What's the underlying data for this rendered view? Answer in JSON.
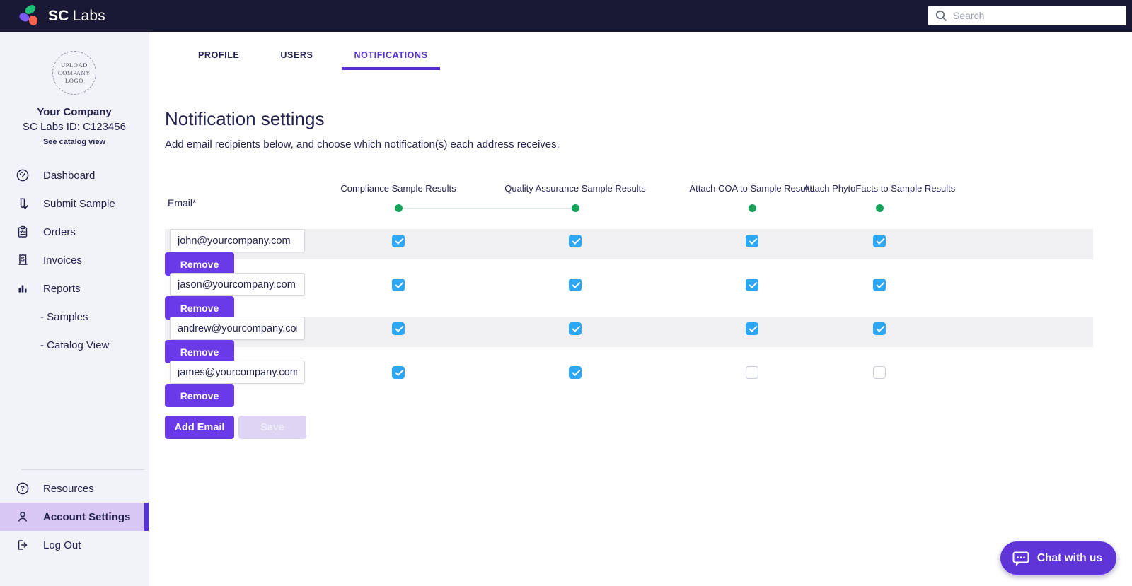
{
  "topbar": {
    "brand_bold": "SC",
    "brand_light": "Labs",
    "search_placeholder": "Search"
  },
  "sidebar": {
    "upload_logo_lines": [
      "UPLOAD",
      "COMPANY",
      "LOGO"
    ],
    "company_name": "Your Company",
    "company_id": "SC Labs ID: C123456",
    "catalog_link": "See catalog view",
    "items": [
      {
        "label": "Dashboard",
        "icon": "dashboard-icon"
      },
      {
        "label": "Submit Sample",
        "icon": "submit-sample-icon"
      },
      {
        "label": "Orders",
        "icon": "orders-icon"
      },
      {
        "label": "Invoices",
        "icon": "invoices-icon"
      },
      {
        "label": "Reports",
        "icon": "reports-icon"
      }
    ],
    "sub_items": [
      {
        "label": "- Samples"
      },
      {
        "label": "- Catalog View"
      }
    ],
    "bottom_items": [
      {
        "label": "Resources",
        "icon": "help-icon",
        "active": false
      },
      {
        "label": "Account Settings",
        "icon": "person-icon",
        "active": true
      },
      {
        "label": "Log Out",
        "icon": "logout-icon",
        "active": false
      }
    ]
  },
  "tabs": [
    {
      "label": "PROFILE",
      "active": false
    },
    {
      "label": "USERS",
      "active": false
    },
    {
      "label": "NOTIFICATIONS",
      "active": true
    }
  ],
  "main": {
    "title": "Notification settings",
    "subtitle": "Add email recipients below, and choose which notification(s) each address receives.",
    "email_label": "Email*",
    "columns": [
      "Compliance Sample Results",
      "Quality Assurance Sample Results",
      "Attach COA to Sample Results",
      "Attach PhytoFacts to Sample Results"
    ],
    "rows": [
      {
        "email": "john@yourcompany.com",
        "checks": [
          true,
          true,
          true,
          true
        ]
      },
      {
        "email": "jason@yourcompany.com",
        "checks": [
          true,
          true,
          true,
          true
        ]
      },
      {
        "email": "andrew@yourcompany.com",
        "checks": [
          true,
          true,
          true,
          true
        ]
      },
      {
        "email": "james@yourcompany.com",
        "checks": [
          true,
          true,
          false,
          false
        ]
      }
    ],
    "remove_label": "Remove",
    "add_email_label": "Add Email",
    "save_label": "Save"
  },
  "chat": {
    "label": "Chat with us"
  },
  "colors": {
    "topbar_navy": "#191936",
    "text_navy": "#232350",
    "accent_purple": "#6a3ae8",
    "tab_purple": "#5731d0",
    "active_sidebar_bg": "#d8c6f4",
    "active_sidebar_bar": "#5630d2",
    "checkbox_blue": "#2da7f3",
    "dot_green": "#18a25c",
    "disabled_save_bg": "#ded4f4",
    "chat_purple": "#5f35d8",
    "logo_green": "#1fc178",
    "logo_purple": "#7a5cf5",
    "logo_orange": "#f2614d"
  }
}
